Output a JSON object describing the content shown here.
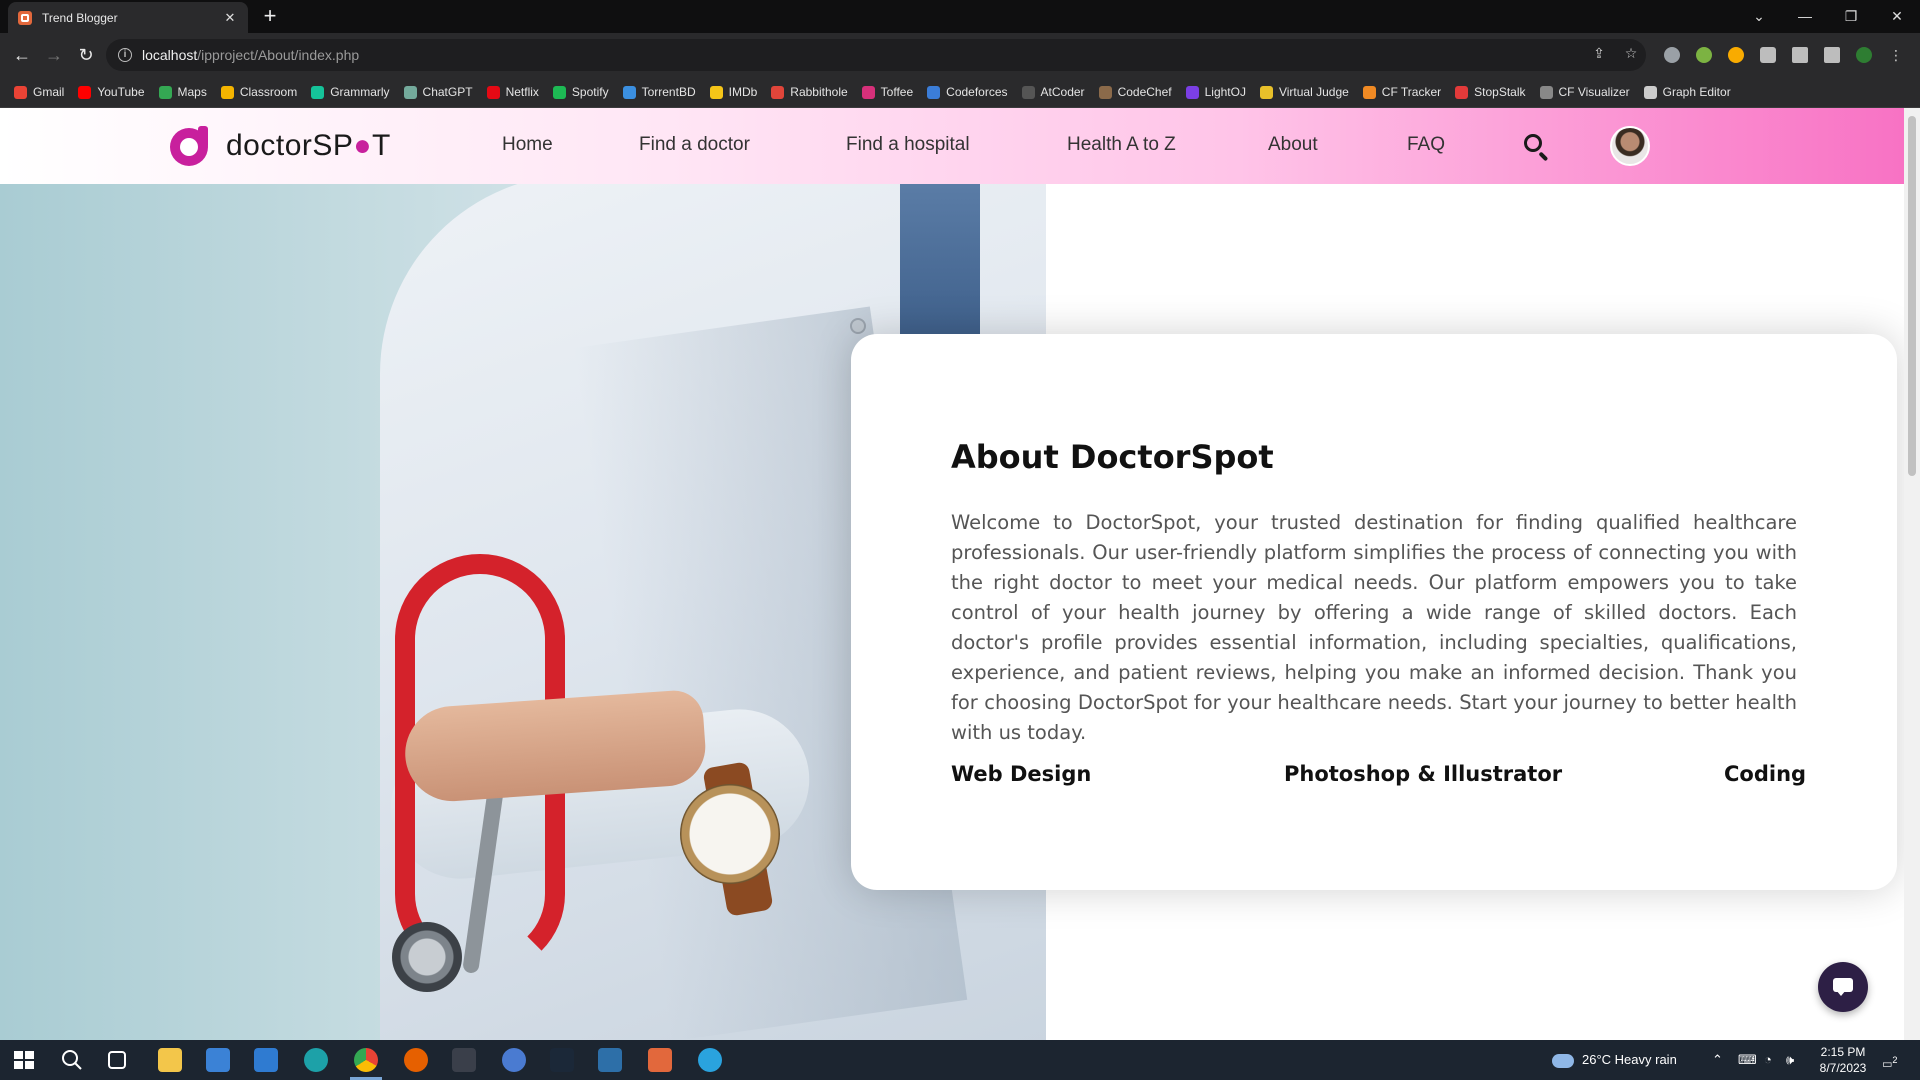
{
  "browser": {
    "tab_title": "Trend Blogger",
    "tab_close": "✕",
    "new_tab": "+",
    "url_host": "localhost",
    "url_path": "/ipproject/About/index.php",
    "controls": {
      "minimize": "—",
      "restore": "❐",
      "close": "✕",
      "dropdown": "⌄"
    },
    "bookmarks": [
      {
        "label": "Gmail",
        "color": "#ea4335"
      },
      {
        "label": "YouTube",
        "color": "#ff0000"
      },
      {
        "label": "Maps",
        "color": "#34a853"
      },
      {
        "label": "Classroom",
        "color": "#f4b400"
      },
      {
        "label": "Grammarly",
        "color": "#15c39a"
      },
      {
        "label": "ChatGPT",
        "color": "#74aa9c"
      },
      {
        "label": "Netflix",
        "color": "#e50914"
      },
      {
        "label": "Spotify",
        "color": "#1db954"
      },
      {
        "label": "TorrentBD",
        "color": "#3b8fe0"
      },
      {
        "label": "IMDb",
        "color": "#f5c518"
      },
      {
        "label": "Rabbithole",
        "color": "#e0453a"
      },
      {
        "label": "Toffee",
        "color": "#d6307a"
      },
      {
        "label": "Codeforces",
        "color": "#3b7dd8"
      },
      {
        "label": "AtCoder",
        "color": "#555555"
      },
      {
        "label": "CodeChef",
        "color": "#8b6a4a"
      },
      {
        "label": "LightOJ",
        "color": "#7b3fe4"
      },
      {
        "label": "Virtual Judge",
        "color": "#e8c02a"
      },
      {
        "label": "CF Tracker",
        "color": "#f08a24"
      },
      {
        "label": "StopStalk",
        "color": "#e23a3a"
      },
      {
        "label": "CF Visualizer",
        "color": "#888888"
      },
      {
        "label": "Graph Editor",
        "color": "#cccccc"
      }
    ]
  },
  "site": {
    "logo_prefix": "doctorSP",
    "logo_pin": "●",
    "logo_suffix": "T",
    "nav": [
      "Home",
      "Find a doctor",
      "Find a hospital",
      "Health A to Z",
      "About",
      "FAQ"
    ],
    "brand_color": "#c8209d"
  },
  "about": {
    "title": "About DoctorSpot",
    "body": "Welcome to DoctorSpot, your trusted destination for finding qualified healthcare professionals. Our user-friendly platform simplifies the process of connecting you with the right doctor to meet your medical needs. Our platform empowers you to take control of your health journey by offering a wide range of skilled doctors. Each doctor's profile provides essential information, including specialties, qualifications, experience, and patient reviews, helping you make an informed decision. Thank you for choosing DoctorSpot for your healthcare needs. Start your journey to better health with us today.",
    "skills": [
      "Web Design",
      "Photoshop & Illustrator",
      "Coding"
    ]
  },
  "taskbar": {
    "weather": "26°C  Heavy rain",
    "time": "2:15 PM",
    "date": "8/7/2023",
    "notification_count": "2"
  }
}
